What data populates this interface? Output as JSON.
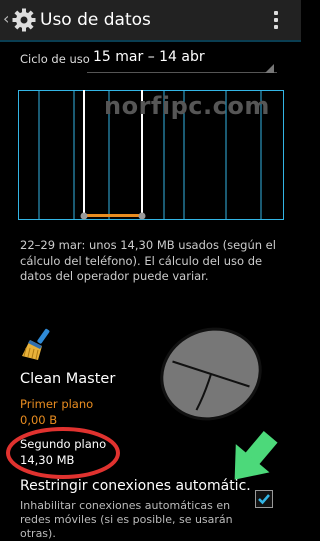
{
  "action_bar": {
    "title": "Uso de datos"
  },
  "cycle": {
    "label": "Ciclo de uso",
    "value": "15 mar – 14 abr"
  },
  "watermark": "norfipc.com",
  "usage_description": "22–29 mar: unos 14,30 MB usados (según el cálculo del teléfono). El cálculo del uso de datos del operador puede variar.",
  "app": {
    "name": "Clean Master",
    "foreground_label": "Primer plano",
    "foreground_value": "0,00 B",
    "background_label": "Segundo plano",
    "background_value": "14,30 MB"
  },
  "restrict": {
    "title": "Restringir conexiones automátic.",
    "description": "Inhabilitar conexiones automáticas en redes móviles (si es posible, se usarán otras).",
    "checked": true
  },
  "colors": {
    "accent": "#33b5e5",
    "warning": "#e88c20",
    "highlight": "#e0322f",
    "arrow": "#4cd97a"
  }
}
